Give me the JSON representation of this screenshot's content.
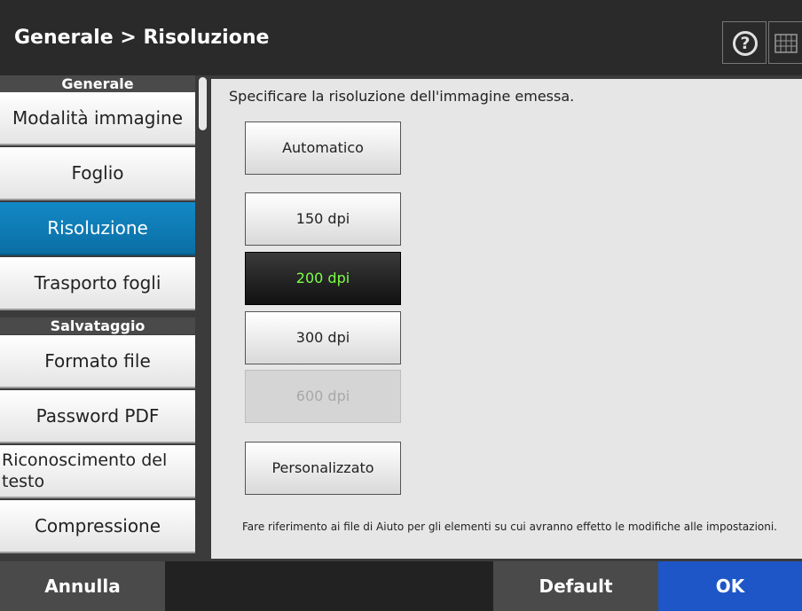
{
  "header": {
    "title": "Generale > Risoluzione",
    "help_glyph": "?",
    "help_icon": "help-icon",
    "keyboard_icon": "keyboard-icon"
  },
  "sidebar": {
    "sections": [
      {
        "header": "Generale",
        "items": [
          "Modalità immagine",
          "Foglio",
          "Risoluzione",
          "Trasporto fogli"
        ]
      },
      {
        "header": "Salvataggio",
        "items": [
          "Formato file",
          "Password PDF",
          "Riconoscimento del testo",
          "Compressione"
        ]
      }
    ],
    "active_item": "Risoluzione"
  },
  "main": {
    "instruction": "Specificare la risoluzione dell'immagine emessa.",
    "options": {
      "automatic": "Automatico",
      "dpi150": "150 dpi",
      "dpi200": "200 dpi",
      "dpi300": "300 dpi",
      "dpi600": "600 dpi",
      "custom": "Personalizzato"
    },
    "selected_option": "200 dpi",
    "disabled_option": "600 dpi",
    "note": "Fare riferimento ai file di Aiuto per gli elementi su cui avranno effetto le modifiche alle impostazioni."
  },
  "footer": {
    "cancel": "Annulla",
    "default": "Default",
    "ok": "OK"
  },
  "colors": {
    "active_item": "#0f7cb8",
    "selected_text": "#7dff4a",
    "ok_button": "#1e56c8"
  }
}
